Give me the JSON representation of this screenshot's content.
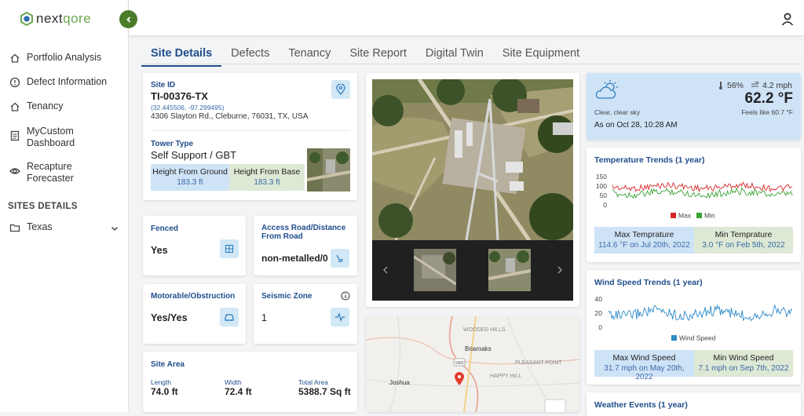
{
  "app": {
    "logo_prefix": "next",
    "logo_suffix": "qore"
  },
  "sidebar": {
    "items": [
      {
        "label": "Portfolio Analysis",
        "icon": "home-icon"
      },
      {
        "label": "Defect Information",
        "icon": "alert-circle-icon"
      },
      {
        "label": "Tenancy",
        "icon": "home-icon"
      },
      {
        "label": "MyCustom\nDashboard",
        "icon": "document-icon"
      },
      {
        "label": "Recapture\nForecaster",
        "icon": "eye-icon"
      }
    ],
    "section_title": "SITES DETAILS",
    "folder": "Texas"
  },
  "tabs": [
    "Site Details",
    "Defects",
    "Tenancy",
    "Site Report",
    "Digital Twin",
    "Site Equipment"
  ],
  "site": {
    "id_label": "Site ID",
    "id": "TI-00376-TX",
    "coords": "(32.445506, -97.299495)",
    "address": "4306 Slayton Rd., Cleburne, 76031, TX, USA",
    "tower_type_label": "Tower Type",
    "tower_type": "Self Support / GBT",
    "hfg_label": "Height From Ground",
    "hfg": "183.3 ft",
    "hfb_label": "Height From Base",
    "hfb": "183.3 ft"
  },
  "fenced": {
    "label": "Fenced",
    "value": "Yes"
  },
  "access": {
    "label": "Access Road/Distance From Road",
    "value": "non-metalled/0"
  },
  "motorable": {
    "label": "Motorable/Obstruction",
    "value": "Yes/Yes"
  },
  "seismic": {
    "label": "Seismic Zone",
    "value": "1"
  },
  "area": {
    "label": "Site Area",
    "length_label": "Length",
    "length": "74.0 ft",
    "width_label": "Width",
    "width": "72.4 ft",
    "total_label": "Total Area",
    "total": "5388.7 Sq ft"
  },
  "map": {
    "places": [
      "WOODED HILLS",
      "Briaroaks",
      "PLEASANT POINT",
      "HAPPY HILL",
      "Joshua"
    ],
    "road": "1902"
  },
  "weather": {
    "humidity": "56%",
    "wind": "4.2 mph",
    "temp": "62.2 °F",
    "condition": "Clear, clear sky",
    "feels": "Feels like 60.7 °F",
    "as_on": "As on Oct 28, 10:28 AM"
  },
  "temp_trends": {
    "title": "Temperature Trends (1 year)",
    "yticks": [
      "150",
      "100",
      "50",
      "0"
    ],
    "legend_max": "Max",
    "legend_min": "Min",
    "max_label": "Max Temprature",
    "max_value": "114.6 °F on Jul 20th, 2022",
    "min_label": "Min Temprature",
    "min_value": "3.0 °F on Feb 5th, 2022",
    "colors": {
      "max": "#d62728",
      "min": "#3aa335"
    }
  },
  "wind_trends": {
    "title": "Wind Speed Trends (1 year)",
    "yticks": [
      "40",
      "20",
      "0"
    ],
    "legend": "Wind Speed",
    "max_label": "Max Wind Speed",
    "max_value": "31.7 mph on May 20th, 2022",
    "min_label": "Min Wind Speed",
    "min_value": "7.1 mph on Sep 7th, 2022",
    "color": "#2e8bc8"
  },
  "events": {
    "title": "Weather Events (1 year)"
  }
}
